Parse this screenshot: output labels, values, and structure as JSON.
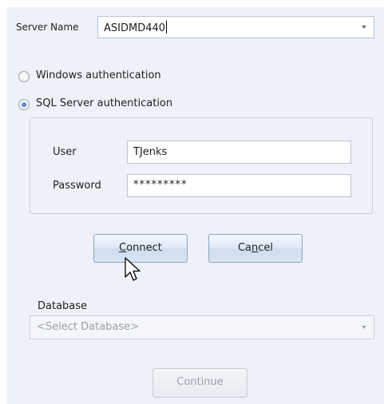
{
  "server": {
    "label": "Server Name",
    "value": "ASIDMD440",
    "dropdown_icon": "chevron-down-icon"
  },
  "auth": {
    "windows_label": "Windows authentication",
    "sql_label": "SQL Server authentication",
    "selected": "sql"
  },
  "credentials": {
    "user_label": "User",
    "user_value": "TJenks",
    "password_label": "Password",
    "password_value": "*********"
  },
  "buttons": {
    "connect_mnemonic": "C",
    "connect_rest": "onnect",
    "cancel_pre": "Ca",
    "cancel_mnemonic": "n",
    "cancel_rest": "cel",
    "continue_label": "Continue"
  },
  "database": {
    "label": "Database",
    "placeholder": "<Select Database>",
    "dropdown_icon": "chevron-down-icon"
  },
  "colors": {
    "panel_bg": "#eef1f8",
    "button_border": "#8aa3c4",
    "radio_dot": "#2a5cae",
    "disabled_text": "#9aa0aa"
  }
}
